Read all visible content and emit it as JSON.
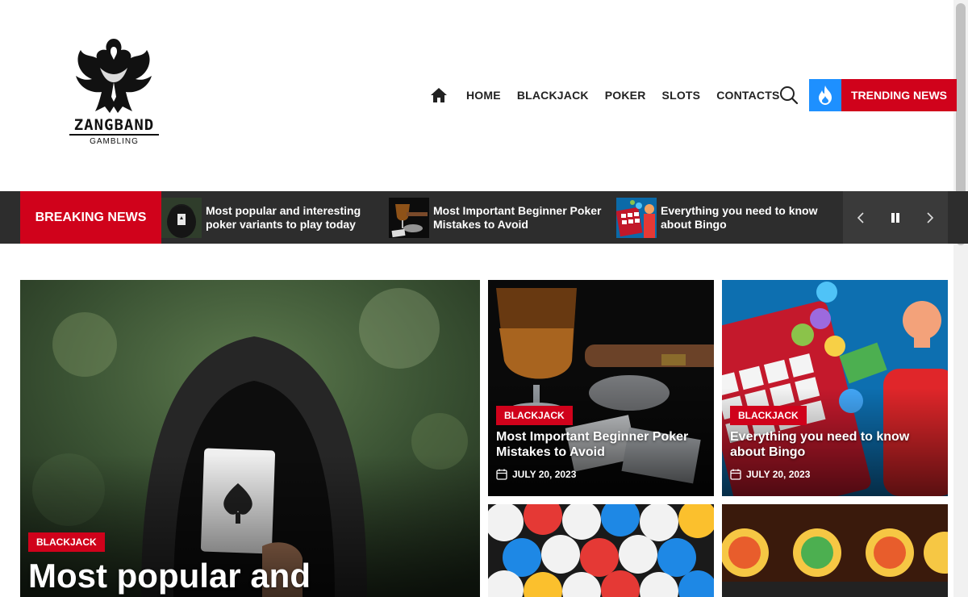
{
  "brand": {
    "name": "ZANGBAND",
    "tagline": "GAMBLING"
  },
  "nav": {
    "items": [
      {
        "label": "HOME"
      },
      {
        "label": "BLACKJACK"
      },
      {
        "label": "POKER"
      },
      {
        "label": "SLOTS"
      },
      {
        "label": "CONTACTS"
      }
    ],
    "home_icon": "home-icon",
    "search_icon": "search-icon",
    "trending": {
      "label": "TRENDING NEWS",
      "icon": "fire-icon",
      "icon_color": "#1e90ff",
      "bg_color": "#d0021b"
    }
  },
  "breaking": {
    "label": "BREAKING NEWS",
    "items": [
      {
        "title": "Most popular and interesting poker variants to play today",
        "thumb": "hooded-card"
      },
      {
        "title": "Most Important Beginner Poker Mistakes to Avoid",
        "thumb": "whiskey-cigar"
      },
      {
        "title": "Everything you need to know about Bingo",
        "thumb": "bingo"
      }
    ],
    "controls": {
      "prev": "chevron-left-icon",
      "pause": "pause-icon",
      "next": "chevron-right-icon"
    }
  },
  "featured": {
    "main": {
      "category": "BLACKJACK",
      "title": "Most popular and"
    },
    "side": [
      {
        "category": "BLACKJACK",
        "title": "Most Important Beginner Poker Mistakes to Avoid",
        "date": "JULY 20, 2023"
      },
      {
        "category": "BLACKJACK",
        "title": "Everything you need to know about Bingo",
        "date": "JULY 20, 2023"
      }
    ]
  },
  "colors": {
    "accent": "#d0021b",
    "dark_bar": "#2d2d2d",
    "trending_blue": "#1e90ff"
  }
}
